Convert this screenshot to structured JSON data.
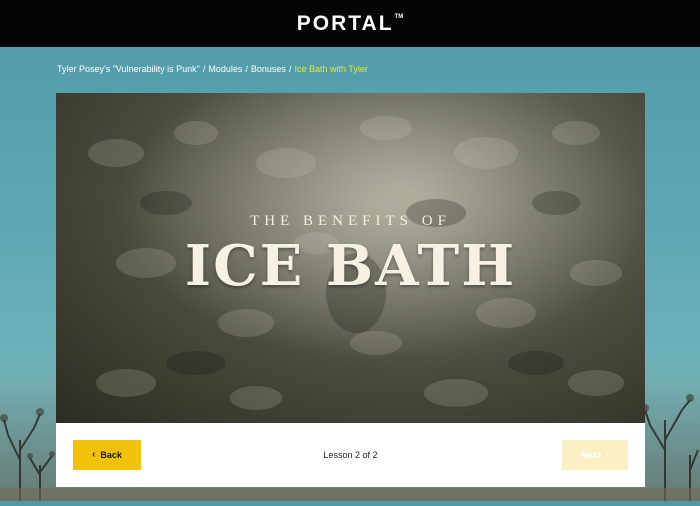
{
  "header": {
    "logo_text": "PORTAL",
    "logo_tm": "TM"
  },
  "breadcrumb": {
    "items": [
      "Tyler Posey's \"Vulnerability is Punk\"",
      "Modules",
      "Bonuses"
    ],
    "current": "Ice Bath with Tyler",
    "separator": "/"
  },
  "video": {
    "subtitle": "THE BENEFITS OF",
    "title": "ICE BATH"
  },
  "lesson_nav": {
    "back_label": "Back",
    "next_label": "Next",
    "counter": "Lesson 2 of 2",
    "back_icon": "chevron-left-icon",
    "next_icon": "chevron-right-icon"
  },
  "colors": {
    "topbar": "#050505",
    "accent": "#f2c20b",
    "accent_disabled": "#fbefc4",
    "breadcrumb_current": "#e8e33a",
    "sky": "#5ea8b3"
  }
}
